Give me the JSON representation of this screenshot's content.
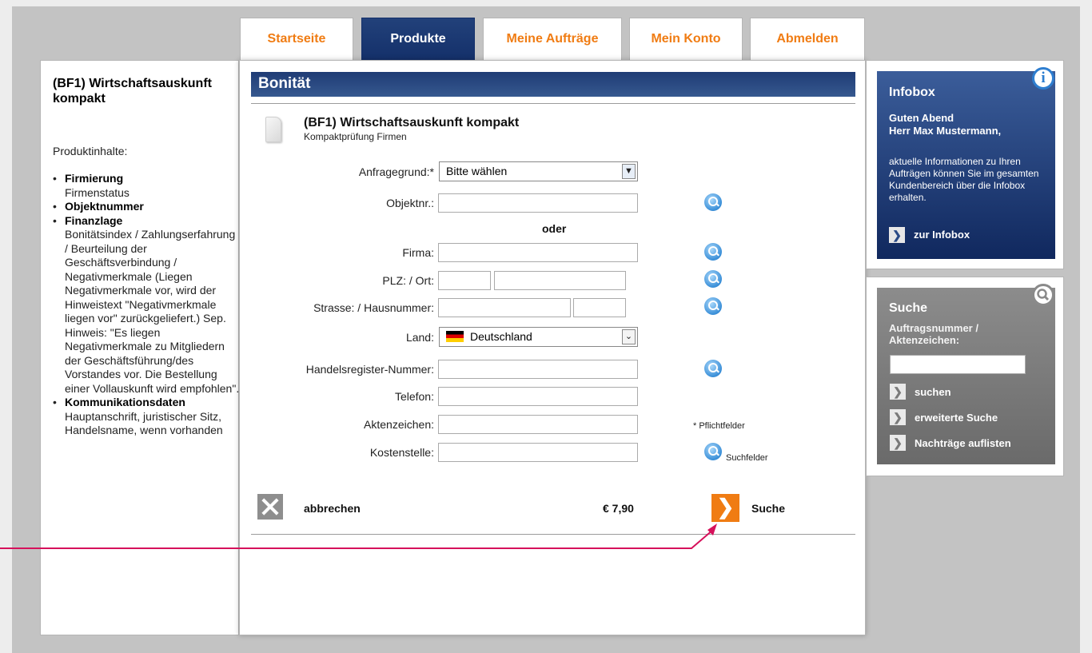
{
  "nav": {
    "tabs": [
      "Startseite",
      "Produkte",
      "Meine Aufträge",
      "Mein Konto",
      "Abmelden"
    ],
    "active": "Produkte"
  },
  "left": {
    "title": "(BF1) Wirtschaftsauskunft kompakt",
    "label": "Produktinhalte:",
    "items": [
      {
        "head": "Firmierung",
        "text": "Firmenstatus"
      },
      {
        "head": "Objektnummer",
        "text": ""
      },
      {
        "head": "Finanzlage",
        "text": "Bonitätsindex / Zahlungserfahrung / Beurteilung der Geschäftsverbindung / Negativmerkmale (Liegen Negativmerkmale vor, wird der Hinweistext \"Negativmerkmale liegen vor\" zurückgeliefert.) Sep. Hinweis: \"Es liegen Negativmerkmale zu Mitgliedern der Geschäftsführung/des Vorstandes vor. Die Bestellung einer Vollauskunft wird empfohlen\"."
      },
      {
        "head": "Kommunikationsdaten",
        "text": "Hauptanschrift, juristischer Sitz, Handelsname, wenn vorhanden"
      }
    ]
  },
  "main": {
    "section_title": "Bonität",
    "product_title": "(BF1) Wirtschaftsauskunft kompakt",
    "product_subtitle": "Kompaktprüfung Firmen",
    "form": {
      "reason_label": "Anfragegrund:*",
      "reason_value": "Bitte wählen",
      "objekt_label": "Objektnr.:",
      "or_label": "oder",
      "firma_label": "Firma:",
      "plz_label": "PLZ: / Ort:",
      "strasse_label": "Strasse: / Hausnummer:",
      "land_label": "Land:",
      "land_value": "Deutschland",
      "hr_label": "Handelsregister-Nummer:",
      "telefon_label": "Telefon:",
      "akten_label": "Aktenzeichen:",
      "kosten_label": "Kostenstelle:"
    },
    "notes": {
      "required": "* Pflichtfelder",
      "search": "Suchfelder"
    },
    "cancel_label": "abbrechen",
    "price": "€ 7,90",
    "submit_label": "Suche"
  },
  "infobox": {
    "title": "Infobox",
    "greeting_1": "Guten Abend",
    "greeting_2": "Herr Max Mustermann,",
    "text": "aktuelle Informationen zu Ihren Aufträgen können Sie im gesamten Kundenbereich über die Infobox erhalten.",
    "link": "zur Infobox",
    "info_icon": "i"
  },
  "search": {
    "title": "Suche",
    "subtitle": "Auftragsnummer / Aktenzeichen:",
    "links": [
      "suchen",
      "erweiterte Suche",
      "Nachträge auflisten"
    ]
  },
  "colors": {
    "accent": "#f07c13",
    "navy": "#14306a",
    "annotation": "#d6115b"
  }
}
